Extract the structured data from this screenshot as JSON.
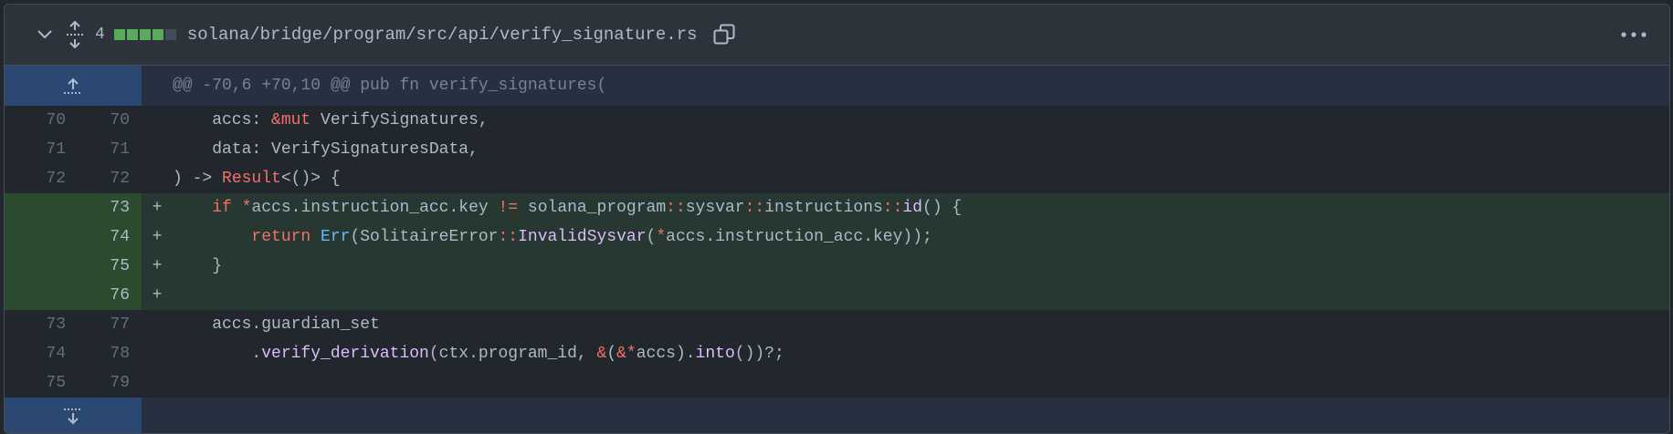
{
  "header": {
    "changes_count": "4",
    "diffstat": [
      "#57ab5a",
      "#57ab5a",
      "#57ab5a",
      "#57ab5a",
      "#444c56"
    ],
    "file_path": "solana/bridge/program/src/api/verify_signature.rs",
    "icons": {
      "collapse": "chevron-down-icon",
      "expand": "unfold-icon",
      "copy": "copy-icon",
      "more": "kebab-horizontal-icon"
    }
  },
  "hunk_header": "@@ -70,6 +70,10 @@ pub fn verify_signatures(",
  "lines": [
    {
      "type": "ctx",
      "old": "70",
      "new": "70",
      "marker": "",
      "segs": [
        {
          "t": "    accs: ",
          "c": ""
        },
        {
          "t": "&mut",
          "c": "k"
        },
        {
          "t": " VerifySignatures,",
          "c": ""
        }
      ]
    },
    {
      "type": "ctx",
      "old": "71",
      "new": "71",
      "marker": "",
      "segs": [
        {
          "t": "    data: VerifySignaturesData,",
          "c": ""
        }
      ]
    },
    {
      "type": "ctx",
      "old": "72",
      "new": "72",
      "marker": "",
      "segs": [
        {
          "t": ") -> ",
          "c": ""
        },
        {
          "t": "Result",
          "c": "k"
        },
        {
          "t": "<()> {",
          "c": ""
        }
      ]
    },
    {
      "type": "add",
      "old": "",
      "new": "73",
      "marker": "+",
      "segs": [
        {
          "t": "    ",
          "c": ""
        },
        {
          "t": "if",
          "c": "k"
        },
        {
          "t": " ",
          "c": ""
        },
        {
          "t": "*",
          "c": "k"
        },
        {
          "t": "accs.instruction_acc.key ",
          "c": ""
        },
        {
          "t": "!=",
          "c": "k"
        },
        {
          "t": " solana_program",
          "c": ""
        },
        {
          "t": "::",
          "c": "k"
        },
        {
          "t": "sysvar",
          "c": ""
        },
        {
          "t": "::",
          "c": "k"
        },
        {
          "t": "instructions",
          "c": ""
        },
        {
          "t": "::",
          "c": "k"
        },
        {
          "t": "id",
          "c": "f"
        },
        {
          "t": "() {",
          "c": ""
        }
      ]
    },
    {
      "type": "add",
      "old": "",
      "new": "74",
      "marker": "+",
      "segs": [
        {
          "t": "        ",
          "c": ""
        },
        {
          "t": "return",
          "c": "k"
        },
        {
          "t": " ",
          "c": ""
        },
        {
          "t": "Err",
          "c": "c"
        },
        {
          "t": "(SolitaireError",
          "c": ""
        },
        {
          "t": "::",
          "c": "k"
        },
        {
          "t": "InvalidSysvar",
          "c": "f"
        },
        {
          "t": "(",
          "c": ""
        },
        {
          "t": "*",
          "c": "k"
        },
        {
          "t": "accs.instruction_acc.key));",
          "c": ""
        }
      ]
    },
    {
      "type": "add",
      "old": "",
      "new": "75",
      "marker": "+",
      "segs": [
        {
          "t": "    }",
          "c": ""
        }
      ]
    },
    {
      "type": "add",
      "old": "",
      "new": "76",
      "marker": "+",
      "segs": []
    },
    {
      "type": "ctx",
      "old": "73",
      "new": "77",
      "marker": "",
      "segs": [
        {
          "t": "    accs.guardian_set",
          "c": ""
        }
      ]
    },
    {
      "type": "ctx",
      "old": "74",
      "new": "78",
      "marker": "",
      "segs": [
        {
          "t": "        .",
          "c": ""
        },
        {
          "t": "verify_derivation",
          "c": "f"
        },
        {
          "t": "(ctx.program_id, ",
          "c": ""
        },
        {
          "t": "&",
          "c": "k"
        },
        {
          "t": "(",
          "c": ""
        },
        {
          "t": "&*",
          "c": "k"
        },
        {
          "t": "accs).",
          "c": ""
        },
        {
          "t": "into",
          "c": "f"
        },
        {
          "t": "())?;",
          "c": ""
        }
      ]
    },
    {
      "type": "ctx",
      "old": "75",
      "new": "79",
      "marker": "",
      "segs": []
    }
  ]
}
